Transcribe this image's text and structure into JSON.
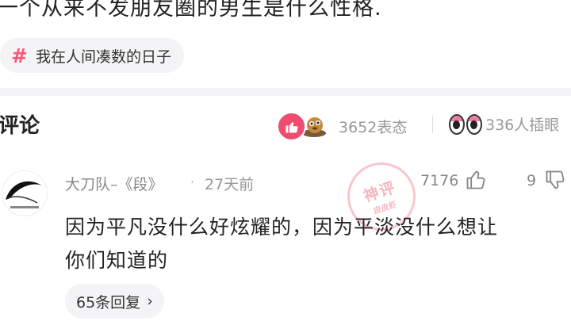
{
  "post": {
    "title": "一个从来不发朋友圈的男生是什么性格.",
    "topic_symbol": "#",
    "topic": "我在人间凑数的日子"
  },
  "comments_header": {
    "title": "评论",
    "reaction_count": "3652表态",
    "viewers": "336人插眼"
  },
  "comment": {
    "username": "大刀队–《段》",
    "separator": "·",
    "time": "27天前",
    "stamp_text": "神评",
    "stamp_sub": "皮皮虾",
    "likes": "7176",
    "dislikes": "9",
    "text": "因为平凡没什么好炫耀的，因为平淡没什么想让\n你们知道的",
    "reply_label": "65条回复",
    "reply_chevron": "›"
  },
  "colors": {
    "accent": "#f04c70",
    "muted": "#999999",
    "chip_bg": "#f4f4f6"
  },
  "icons": [
    "hashtag-icon",
    "like-reaction-icon",
    "emoji-reaction-icon",
    "eyes-icon",
    "thumbs-up-icon",
    "thumbs-down-icon",
    "chevron-right-icon"
  ]
}
